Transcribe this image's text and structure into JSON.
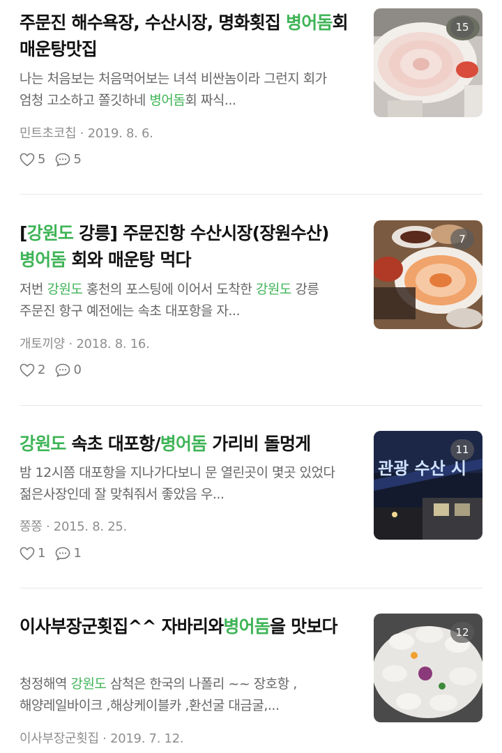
{
  "colors": {
    "highlight": "#3fb457",
    "title": "#111111",
    "snippet": "#666666",
    "meta": "#8e8e8e",
    "divider": "#e8e8e8"
  },
  "icons": {
    "like": "heart-outline-icon",
    "comment": "speech-bubble-icon"
  },
  "posts": [
    {
      "title_parts": [
        "주문진 해수욕장, 수산시장, 명화횟집 ",
        "병어돔",
        "회 매운탕맛집"
      ],
      "snippet_parts": [
        "나는 처음보는 처음먹어보는 녀석 비싼놈이라 그런지 회가 엄청 고소하고 쫄깃하네 ",
        "병어돔",
        "회 짜식..."
      ],
      "author": "민트초코칩",
      "date": "2019. 8. 6.",
      "likes": "5",
      "comments": "5",
      "photo_count": "15"
    },
    {
      "title_parts": [
        "[",
        "강원도",
        " 강릉] 주문진항 수산시장(장원수산) ",
        "병어돔",
        " 회와 매운탕 먹다"
      ],
      "snippet_parts": [
        "저번 ",
        "강원도",
        " 홍천의 포스팅에 이어서 도착한 ",
        "강원도",
        " 강릉 주문진 항구 예전에는 속초 대포항을 자..."
      ],
      "author": "개토끼양",
      "date": "2018. 8. 16.",
      "likes": "2",
      "comments": "0",
      "photo_count": "7"
    },
    {
      "title_parts": [
        "강원도",
        " 속초 대포항/",
        "병어돔",
        " 가리비 돌멍게"
      ],
      "snippet_parts": [
        "밤 12시쯤 대포항을 지나가다보니 문 열린곳이 몇곳 있었다 젊은사장인데 잘 맞춰줘서 좋았음 우..."
      ],
      "author": "쫑쫑",
      "date": "2015. 8. 25.",
      "likes": "1",
      "comments": "1",
      "photo_count": "11",
      "photo_sign_text": "관광 수산 시"
    },
    {
      "title_parts": [
        "이사부장군횟집^^ 자바리와",
        "병어돔",
        "을 맛보다"
      ],
      "snippet_parts": [
        "청정해역 ",
        "강원도",
        " 삼척은 한국의 나폴리 ~~ 장호항 ,해양레일바이크 ,해상케이블카 ,환선굴 대금굴,..."
      ],
      "author": "이사부장군횟집",
      "date": "2019. 7. 12.",
      "photo_count": "12"
    }
  ]
}
